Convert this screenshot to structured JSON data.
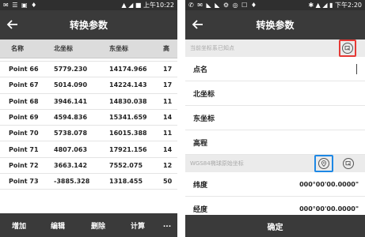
{
  "left": {
    "status": {
      "time": "上午10:22",
      "icons": "▲ ◢ ■"
    },
    "title": "转换参数",
    "columns": [
      "名称",
      "北坐标",
      "东坐标",
      "高"
    ],
    "rows": [
      {
        "name": "Point 66",
        "n": "5779.230",
        "e": "14174.966",
        "h": "17"
      },
      {
        "name": "Point 67",
        "n": "5014.090",
        "e": "14224.143",
        "h": "17"
      },
      {
        "name": "Point 68",
        "n": "3946.141",
        "e": "14830.038",
        "h": "11"
      },
      {
        "name": "Point 69",
        "n": "4594.836",
        "e": "15341.659",
        "h": "14"
      },
      {
        "name": "Point 70",
        "n": "5738.078",
        "e": "16015.388",
        "h": "11"
      },
      {
        "name": "Point 71",
        "n": "4807.063",
        "e": "17921.156",
        "h": "14"
      },
      {
        "name": "Point 72",
        "n": "3663.142",
        "e": "7552.075",
        "h": "12"
      },
      {
        "name": "Point 73",
        "n": "-3885.328",
        "e": "1318.455",
        "h": "50"
      }
    ],
    "toolbar": {
      "add": "增加",
      "edit": "编辑",
      "delete": "删除",
      "calc": "计算",
      "more": "..."
    }
  },
  "right": {
    "status": {
      "time": "下午2:20"
    },
    "title": "转换参数",
    "known_point_header": "当前坐标系已知点",
    "fields": {
      "name": "点名",
      "north": "北坐标",
      "east": "东坐标",
      "height": "高程"
    },
    "wgs_header": "WGS84椭球原始坐标",
    "lat_label": "纬度",
    "lat_value": "000°00'00.0000\"",
    "lon_label": "经度",
    "lon_value": "000°00'00.0000\"",
    "confirm": "确定"
  },
  "colors": {
    "dark_bar": "#3a3a3a",
    "highlight_red": "#e53935",
    "highlight_blue": "#1e88e5"
  }
}
